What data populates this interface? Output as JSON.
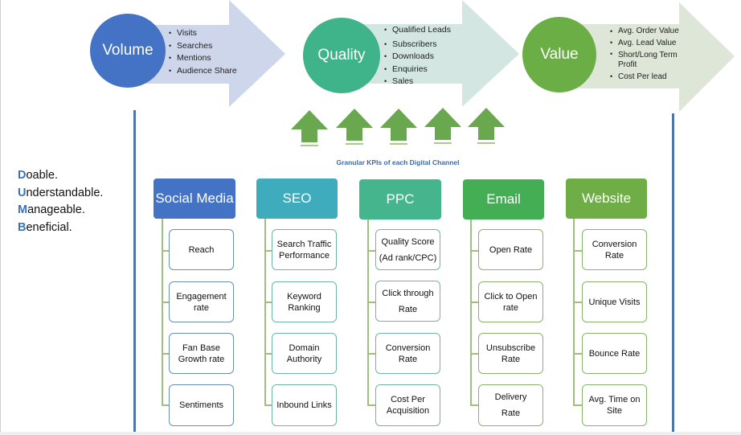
{
  "stages": [
    {
      "title": "Volume",
      "color": "#4472c4",
      "arrow_color": "#cdd6eb",
      "items": [
        "Visits",
        "Searches",
        "Mentions",
        "Audience Share"
      ]
    },
    {
      "title": "Quality",
      "color": "#3fb38a",
      "arrow_color": "#d3e6e2",
      "items": [
        "Qualified Leads",
        "Subscribers",
        "Downloads",
        "Enquiries",
        "Sales"
      ]
    },
    {
      "title": "Value",
      "color": "#6aae45",
      "arrow_color": "#dde6d7",
      "items": [
        "Avg. Order Value",
        "Avg. Lead Value",
        "Short/Long Term Profit",
        "Cost Per lead"
      ]
    }
  ],
  "up_arrow_color": "#6aa84f",
  "caption": "Granular KPIs of each Digital Channel",
  "acronym": [
    {
      "initial": "D",
      "rest": "oable."
    },
    {
      "initial": "U",
      "rest": "nderstandable."
    },
    {
      "initial": "M",
      "rest": "anageable."
    },
    {
      "initial": "B",
      "rest": "eneficial."
    }
  ],
  "channels": [
    {
      "name": "Social Media",
      "color": "#4472c4",
      "kpis": [
        "Reach",
        "Engagement rate",
        "Fan Base Growth rate",
        "Sentiments"
      ]
    },
    {
      "name": "SEO",
      "color": "#3eacbc",
      "kpis": [
        "Search Traffic Performance",
        "Keyword Ranking",
        "Domain Authority",
        "Inbound Links"
      ]
    },
    {
      "name": "PPC",
      "color": "#44b58d",
      "kpis": [
        "Quality Score (Ad rank/CPC)",
        "Click through Rate",
        "Conversion Rate",
        "Cost Per Acquisition"
      ]
    },
    {
      "name": "Email",
      "color": "#43ae53",
      "kpis": [
        "Open Rate",
        "Click to Open rate",
        "Unsubscribe Rate",
        "Delivery Rate"
      ]
    },
    {
      "name": "Website",
      "color": "#6fad47",
      "kpis": [
        "Conversion Rate",
        "Unique Visits",
        "Bounce Rate",
        "Avg. Time on Site"
      ]
    }
  ]
}
